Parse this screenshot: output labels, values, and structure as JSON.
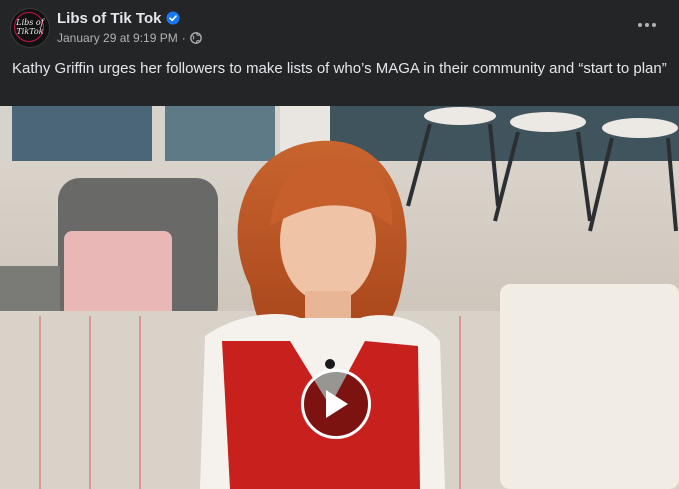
{
  "post": {
    "author": "Libs of Tik Tok",
    "avatar_text": "Libs of TikTok",
    "timestamp": "January 29 at 9:19 PM",
    "separator": "·",
    "caption": "Kathy Griffin urges her followers to make lists of who’s MAGA in their community and “start to plan”"
  },
  "icons": {
    "verified": "verified-badge-icon",
    "audience": "globe-icon",
    "menu": "more-horizontal-icon",
    "play": "play-icon"
  },
  "colors": {
    "background": "#242526",
    "text_primary": "#e4e6eb",
    "text_secondary": "#b0b3b8",
    "verified_blue": "#1877f2",
    "sweater_red": "#c8201c"
  }
}
